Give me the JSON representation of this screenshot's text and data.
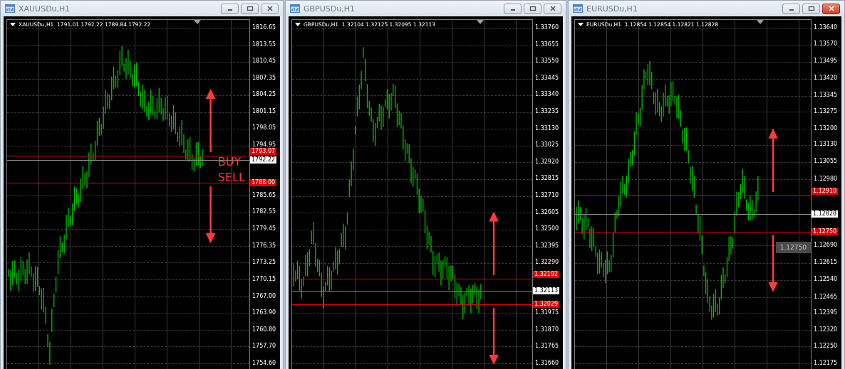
{
  "windows": [
    {
      "title": "XAUUSDu,H1",
      "active": false,
      "header": "XAUUSDu,H1  1791.01 1792.22 1789.84 1792.22",
      "yticks": [
        "1816.65",
        "1813.55",
        "1810.45",
        "1807.35",
        "1804.25",
        "1801.15",
        "1798.05",
        "1794.95",
        "1785.65",
        "1782.55",
        "1779.45",
        "1776.35",
        "1773.25",
        "1770.15",
        "1767.00",
        "1763.90",
        "1760.80",
        "1757.70",
        "1754.60"
      ],
      "lines": [
        {
          "kind": "order",
          "price": "1793.07"
        },
        {
          "kind": "bid",
          "price": "1792.22"
        },
        {
          "kind": "order",
          "price": "1788.00"
        }
      ],
      "annotations": [
        {
          "text": "BUY"
        },
        {
          "text": "SELL"
        }
      ]
    },
    {
      "title": "GBPUSDu,H1",
      "active": false,
      "header": "GBPUSDu,H1  1.32104 1.32125 1.32095 1.32113",
      "yticks": [
        "1.33760",
        "1.33655",
        "1.33550",
        "1.33445",
        "1.33340",
        "1.33235",
        "1.33130",
        "1.33025",
        "1.32920",
        "1.32815",
        "1.32710",
        "1.32605",
        "1.32500",
        "1.32395",
        "1.32290",
        "1.31975",
        "1.31870",
        "1.31765",
        "1.31660"
      ],
      "lines": [
        {
          "kind": "order",
          "price": "1.32192"
        },
        {
          "kind": "bid",
          "price": "1.32113"
        },
        {
          "kind": "order",
          "price": "1.32029"
        }
      ]
    },
    {
      "title": "EURUSDu,H1",
      "active": true,
      "header": "EURUSDu,H1  1.12854 1.12854 1.12821 1.12828",
      "yticks": [
        "1.13640",
        "1.13570",
        "1.13495",
        "1.13420",
        "1.13345",
        "1.13275",
        "1.13200",
        "1.13130",
        "1.13055",
        "1.12980",
        "1.12690",
        "1.12615",
        "1.12540",
        "1.12465",
        "1.12395",
        "1.12320",
        "1.12250",
        "1.12175"
      ],
      "lines": [
        {
          "kind": "order",
          "price": "1.12910"
        },
        {
          "kind": "bid",
          "price": "1.12828"
        },
        {
          "kind": "order",
          "price": "1.12750"
        }
      ],
      "tooltip": "1.12750"
    }
  ]
}
